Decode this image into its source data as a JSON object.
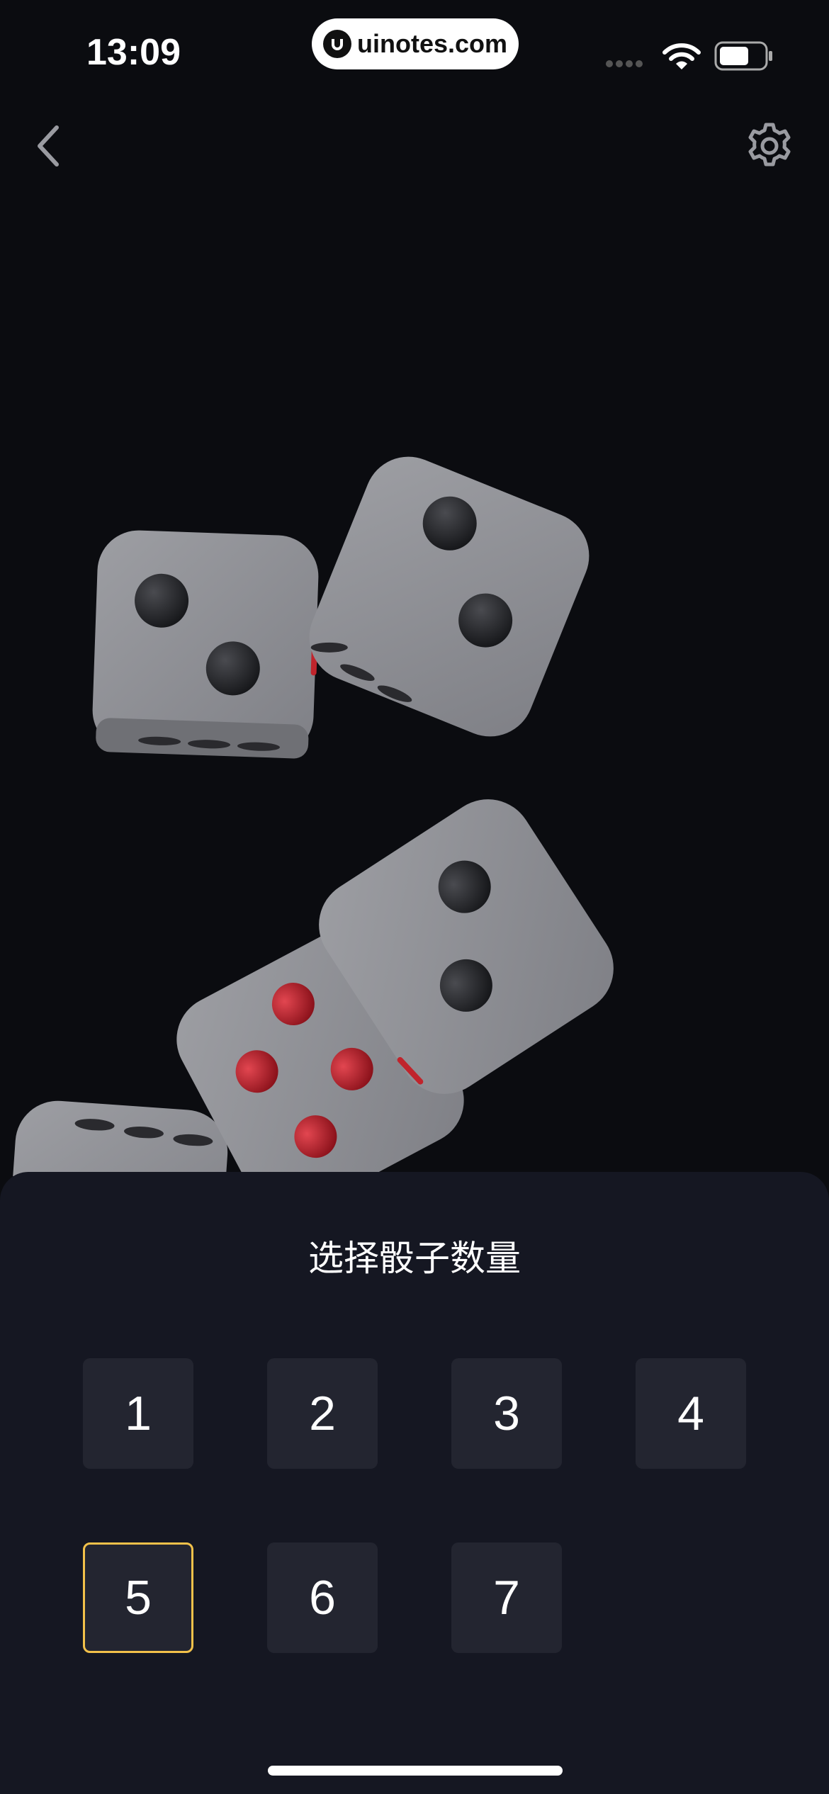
{
  "status_bar": {
    "time": "13:09",
    "watermark": "uinotes.com",
    "icons": [
      "signal-icon",
      "wifi-icon",
      "battery-icon"
    ]
  },
  "nav": {
    "back_icon": "back-icon",
    "settings_icon": "gear-icon"
  },
  "dice": [
    {
      "face_value": 2,
      "pip_color": "#2a2a2e"
    },
    {
      "face_value": 2,
      "pip_color": "#2a2a2e"
    },
    {
      "face_value": 2,
      "pip_color": "#2a2a2e"
    },
    {
      "face_value": 4,
      "pip_color": "#c0242c"
    }
  ],
  "sheet": {
    "title": "选择骰子数量",
    "options": [
      {
        "label": "1",
        "selected": false
      },
      {
        "label": "2",
        "selected": false
      },
      {
        "label": "3",
        "selected": false
      },
      {
        "label": "4",
        "selected": false
      },
      {
        "label": "5",
        "selected": true
      },
      {
        "label": "6",
        "selected": false
      },
      {
        "label": "7",
        "selected": false
      }
    ]
  },
  "colors": {
    "background": "#0b0c10",
    "sheet": "#151722",
    "option_bg": "#232530",
    "selected_border": "#f2c14a",
    "die_face": "#8c8d92",
    "red_pip": "#c0242c"
  }
}
